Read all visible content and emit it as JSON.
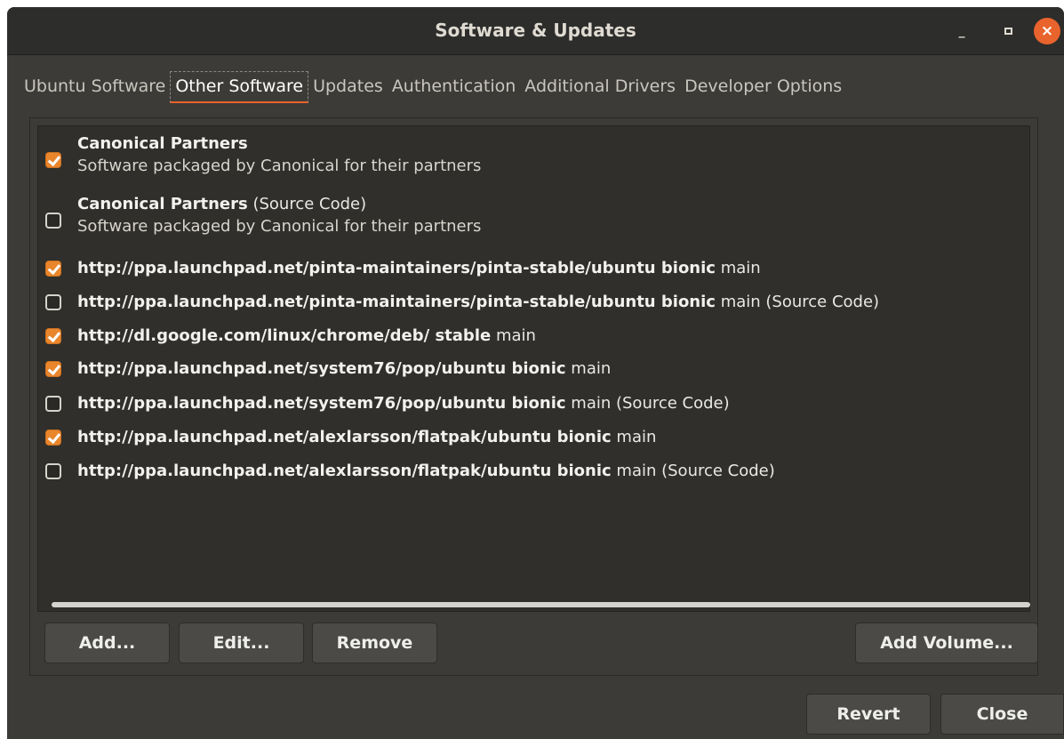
{
  "window": {
    "title": "Software & Updates",
    "minimize_glyph": "_",
    "close_glyph": "×"
  },
  "tabs": [
    {
      "label": "Ubuntu Software",
      "active": false
    },
    {
      "label": "Other Software",
      "active": true
    },
    {
      "label": "Updates",
      "active": false
    },
    {
      "label": "Authentication",
      "active": false
    },
    {
      "label": "Additional Drivers",
      "active": false
    },
    {
      "label": "Developer Options",
      "active": false
    }
  ],
  "sources": [
    {
      "checked": true,
      "name": "Canonical Partners",
      "suffix": "",
      "description": "Software packaged by Canonical for their partners"
    },
    {
      "checked": false,
      "name": "Canonical Partners",
      "suffix": "(Source Code)",
      "description": "Software packaged by Canonical for their partners"
    },
    {
      "checked": true,
      "name": "http://ppa.launchpad.net/pinta-maintainers/pinta-stable/ubuntu bionic",
      "suffix": "main"
    },
    {
      "checked": false,
      "name": "http://ppa.launchpad.net/pinta-maintainers/pinta-stable/ubuntu bionic",
      "suffix": "main (Source Code)"
    },
    {
      "checked": true,
      "name": "http://dl.google.com/linux/chrome/deb/ stable",
      "suffix": "main"
    },
    {
      "checked": true,
      "name": "http://ppa.launchpad.net/system76/pop/ubuntu bionic",
      "suffix": "main"
    },
    {
      "checked": false,
      "name": "http://ppa.launchpad.net/system76/pop/ubuntu bionic",
      "suffix": "main (Source Code)"
    },
    {
      "checked": true,
      "name": "http://ppa.launchpad.net/alexlarsson/flatpak/ubuntu bionic",
      "suffix": "main"
    },
    {
      "checked": false,
      "name": "http://ppa.launchpad.net/alexlarsson/flatpak/ubuntu bionic",
      "suffix": "main (Source Code)"
    }
  ],
  "buttons": {
    "add": "Add...",
    "edit": "Edit...",
    "remove": "Remove",
    "add_volume": "Add Volume...",
    "revert": "Revert",
    "close": "Close"
  },
  "colors": {
    "accent": "#e9632c",
    "checkbox_on": "#e9862c",
    "window_bg": "#3c3b37",
    "titlebar_bg": "#2d2d2b"
  }
}
